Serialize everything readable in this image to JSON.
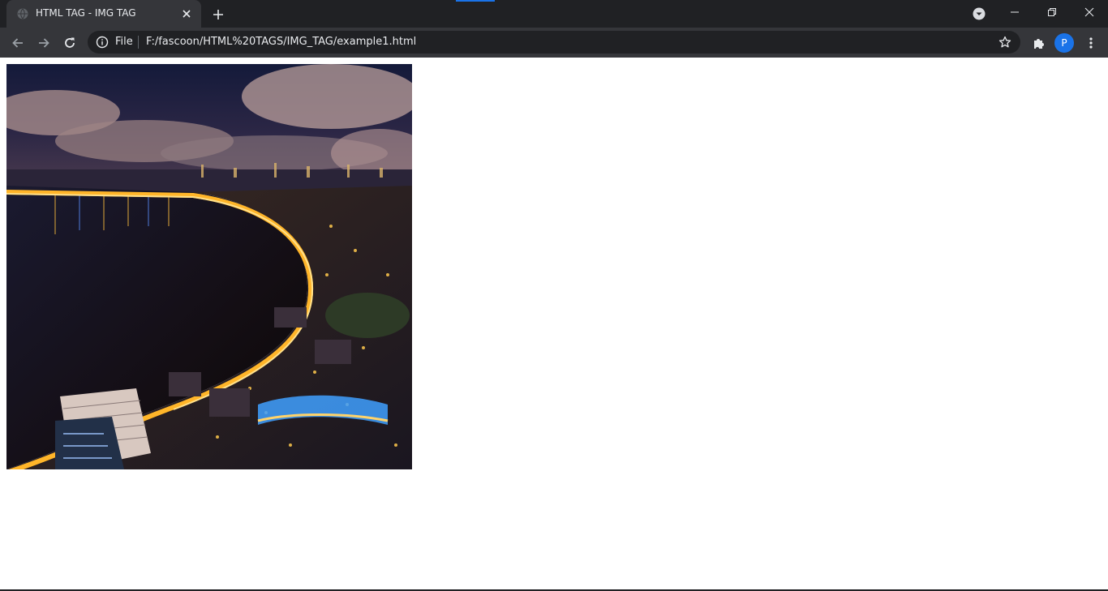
{
  "tab": {
    "title": "HTML TAG - IMG TAG",
    "favicon": "globe-icon"
  },
  "toolbar": {
    "site_chip": "File",
    "url": "F:/fascoon/HTML%20TAGS/IMG_TAG/example1.html",
    "profile_initial": "P"
  },
  "icons": {
    "back": "arrow-left-icon",
    "forward": "arrow-right-icon",
    "reload": "reload-icon",
    "info": "info-icon",
    "bookmark": "star-icon",
    "extensions": "puzzle-icon",
    "menu": "kebab-menu-icon",
    "new_tab": "plus-icon",
    "tab_search": "chevron-down-icon"
  },
  "page": {
    "image_description_visual_only": true
  },
  "colors": {
    "chrome_dark": "#202124",
    "toolbar": "#35363a",
    "accent": "#1a73e8",
    "page_bg": "#ffffff"
  }
}
